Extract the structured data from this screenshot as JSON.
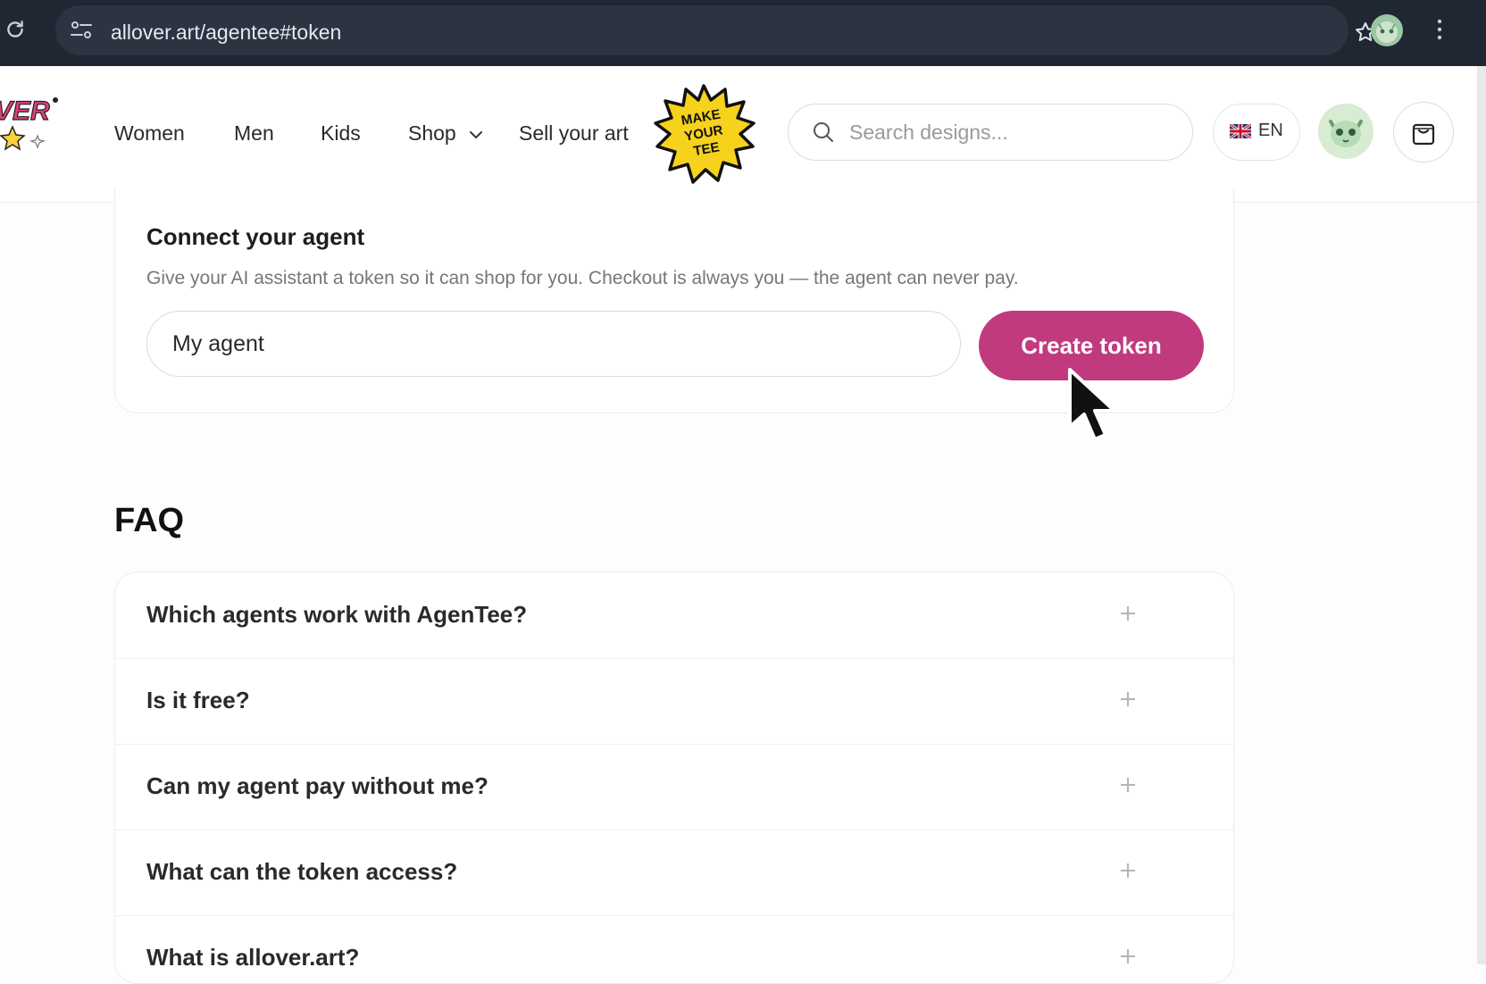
{
  "browser": {
    "url": "allover.art/agentee#token"
  },
  "header": {
    "logo_text": "VER",
    "nav": [
      {
        "label": "Women"
      },
      {
        "label": "Men"
      },
      {
        "label": "Kids"
      },
      {
        "label": "Shop"
      },
      {
        "label": "Sell your art"
      }
    ],
    "sticker_lines": [
      "MAKE",
      "YOUR",
      "TEE"
    ],
    "search_placeholder": "Search designs...",
    "language": "EN"
  },
  "connect": {
    "title": "Connect your agent",
    "description": "Give your AI assistant a token so it can shop for you. Checkout is always you — the agent can never pay.",
    "input_value": "My agent",
    "button_label": "Create token"
  },
  "faq": {
    "title": "FAQ",
    "items": [
      {
        "question": "Which agents work with AgenTee?"
      },
      {
        "question": "Is it free?"
      },
      {
        "question": "Can my agent pay without me?"
      },
      {
        "question": "What can the token access?"
      },
      {
        "question": "What is allover.art?"
      }
    ]
  },
  "colors": {
    "accent": "#c13a7e",
    "chrome": "#1f2733"
  }
}
